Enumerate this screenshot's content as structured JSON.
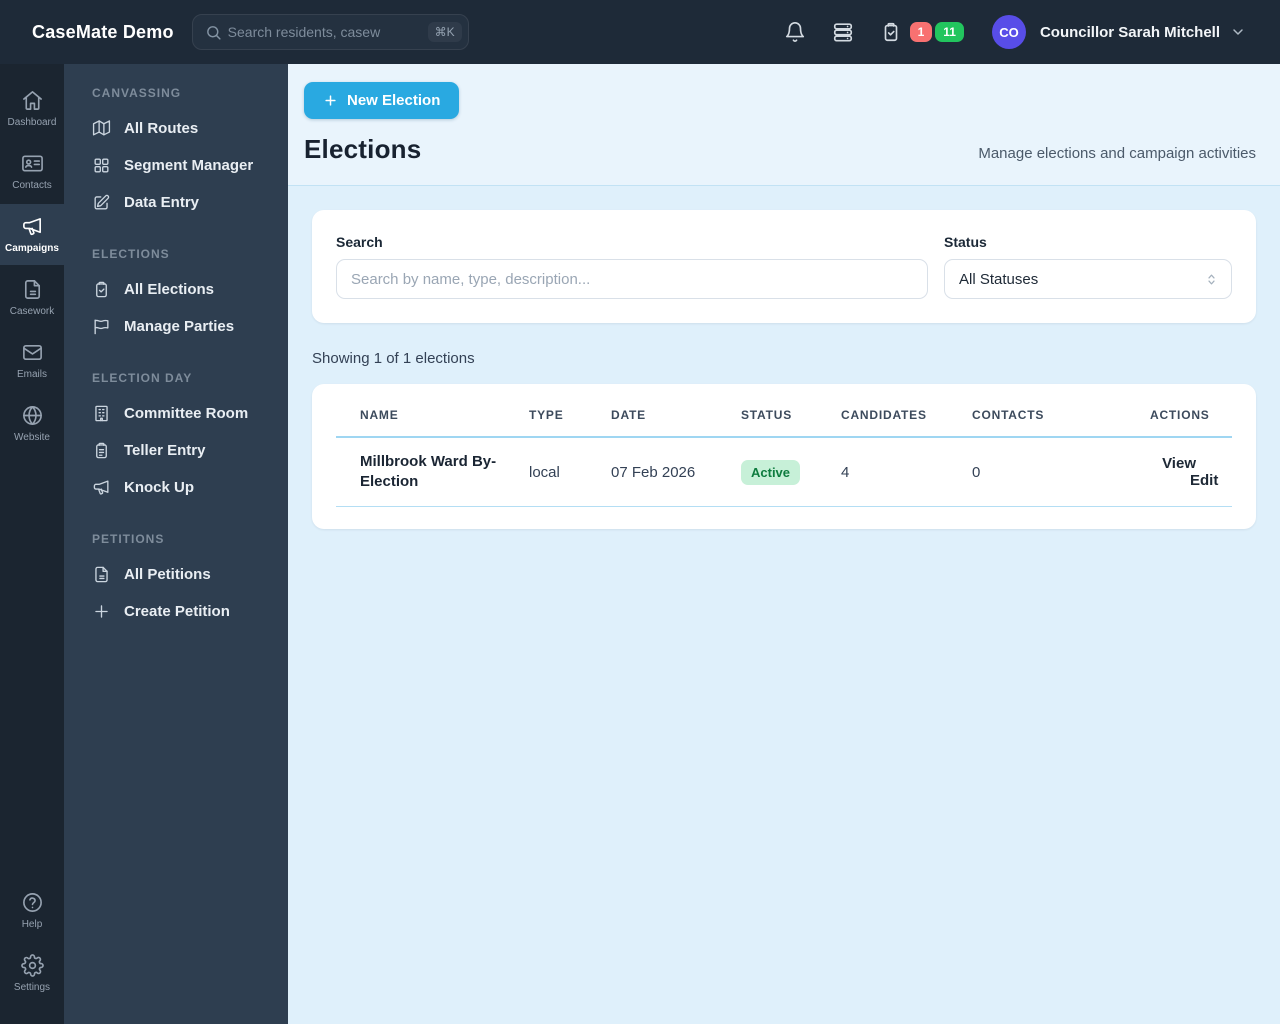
{
  "topbar": {
    "logo": "CaseMate Demo",
    "search_placeholder": "Search residents, casew",
    "shortcut": "⌘K",
    "badge_red": "1",
    "badge_green": "11",
    "user_initials": "CO",
    "user_name": "Councillor Sarah Mitchell"
  },
  "rail": {
    "items": [
      {
        "label": "Dashboard",
        "icon": "home-icon",
        "active": false
      },
      {
        "label": "Contacts",
        "icon": "id-card-icon",
        "active": false
      },
      {
        "label": "Campaigns",
        "icon": "megaphone-icon",
        "active": true
      },
      {
        "label": "Casework",
        "icon": "document-icon",
        "active": false
      },
      {
        "label": "Emails",
        "icon": "envelope-icon",
        "active": false
      },
      {
        "label": "Website",
        "icon": "globe-icon",
        "active": false
      }
    ],
    "bottom_items": [
      {
        "label": "Help",
        "icon": "question-circle-icon"
      },
      {
        "label": "Settings",
        "icon": "gear-icon"
      }
    ]
  },
  "sidebar": {
    "sections": [
      {
        "title": "CANVASSING",
        "items": [
          {
            "label": "All Routes",
            "icon": "map-icon"
          },
          {
            "label": "Segment Manager",
            "icon": "grid-icon"
          },
          {
            "label": "Data Entry",
            "icon": "pencil-square-icon"
          }
        ]
      },
      {
        "title": "ELECTIONS",
        "items": [
          {
            "label": "All Elections",
            "icon": "clipboard-check-icon"
          },
          {
            "label": "Manage Parties",
            "icon": "flag-icon"
          }
        ]
      },
      {
        "title": "ELECTION DAY",
        "items": [
          {
            "label": "Committee Room",
            "icon": "building-icon"
          },
          {
            "label": "Teller Entry",
            "icon": "clipboard-list-icon"
          },
          {
            "label": "Knock Up",
            "icon": "megaphone-icon"
          }
        ]
      },
      {
        "title": "PETITIONS",
        "items": [
          {
            "label": "All Petitions",
            "icon": "document-icon"
          },
          {
            "label": "Create Petition",
            "icon": "plus-icon"
          }
        ]
      }
    ]
  },
  "main": {
    "new_button_label": "New Election",
    "title": "Elections",
    "subtitle": "Manage elections and campaign activities",
    "filters": {
      "search_label": "Search",
      "search_placeholder": "Search by name, type, description...",
      "status_label": "Status",
      "status_value": "All Statuses"
    },
    "summary": "Showing 1 of 1 elections",
    "table": {
      "columns": [
        "NAME",
        "TYPE",
        "DATE",
        "STATUS",
        "CANDIDATES",
        "CONTACTS",
        "ACTIONS"
      ],
      "rows": [
        {
          "name": "Millbrook Ward By-Election",
          "type": "local",
          "date": "07 Feb 2026",
          "status": "Active",
          "candidates": "4",
          "contacts": "0",
          "actions": [
            "View",
            "Edit"
          ]
        }
      ]
    }
  },
  "colors": {
    "accent": "#29A9E1",
    "topbar_bg": "#1E2A38",
    "rail_bg": "#1B2530",
    "panel_bg": "#2E3E50",
    "header_band_bg": "#E9F4FC",
    "content_bg": "#DFF0FB",
    "status_active_bg": "#C7F0D8",
    "status_active_text": "#0E7C3F",
    "badge_red": "#F87171",
    "badge_green": "#22C55E",
    "avatar_bg": "#584DE8"
  },
  "icons": {
    "search": "magnifier glyph",
    "bell": "notification bell",
    "server": "stacked server racks",
    "clipboard-check": "clipboard with check",
    "chevron-down": "caret",
    "chevrons-up-down": "select caret pair",
    "plus": "plus sign"
  }
}
